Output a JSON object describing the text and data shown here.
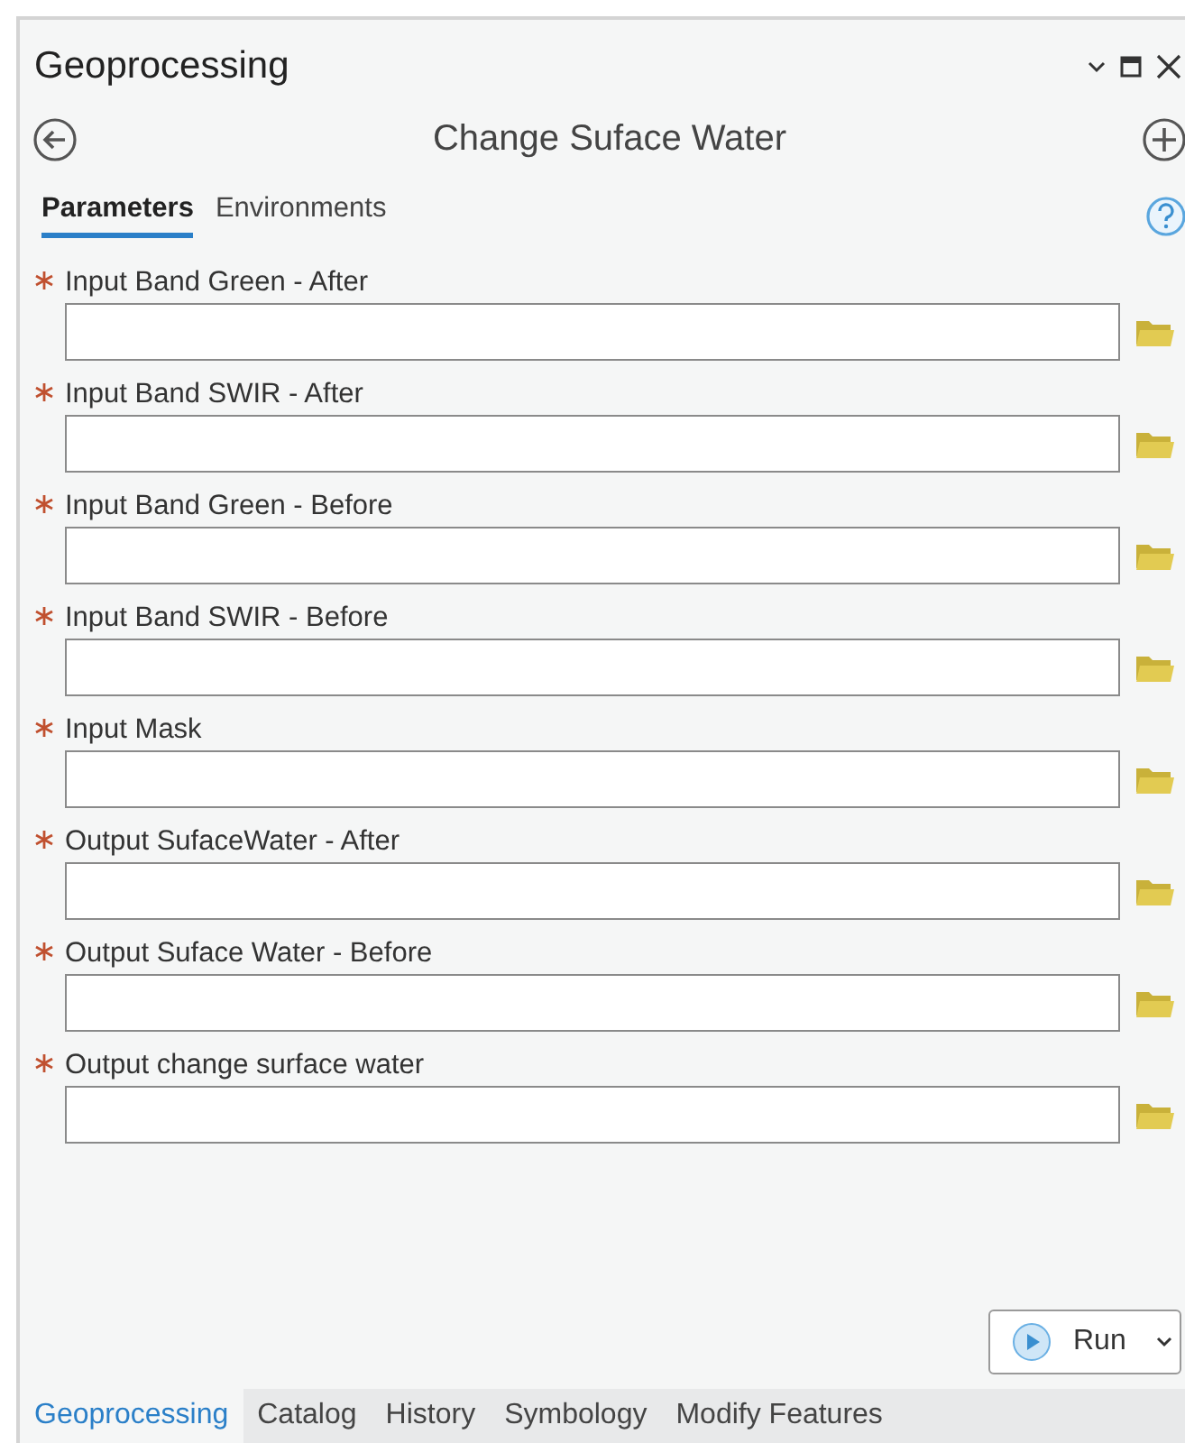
{
  "window": {
    "title": "Geoprocessing"
  },
  "tool": {
    "title": "Change Suface Water"
  },
  "tabs": [
    {
      "label": "Parameters",
      "selected": true
    },
    {
      "label": "Environments",
      "selected": false
    }
  ],
  "parameters": [
    {
      "label": "Input Band Green - After",
      "required": true
    },
    {
      "label": "Input Band SWIR - After",
      "required": true
    },
    {
      "label": "Input Band Green - Before",
      "required": true
    },
    {
      "label": "Input Band SWIR - Before",
      "required": true
    },
    {
      "label": "Input Mask",
      "required": true
    },
    {
      "label": "Output SufaceWater - After",
      "required": true
    },
    {
      "label": "Output Suface Water - Before",
      "required": true
    },
    {
      "label": "Output change surface water",
      "required": true
    }
  ],
  "run_button": {
    "label": "Run"
  },
  "bottom_tabs": [
    {
      "label": "Geoprocessing",
      "selected": true
    },
    {
      "label": "Catalog",
      "selected": false
    },
    {
      "label": "History",
      "selected": false
    },
    {
      "label": "Symbology",
      "selected": false
    },
    {
      "label": "Modify Features",
      "selected": false
    }
  ]
}
